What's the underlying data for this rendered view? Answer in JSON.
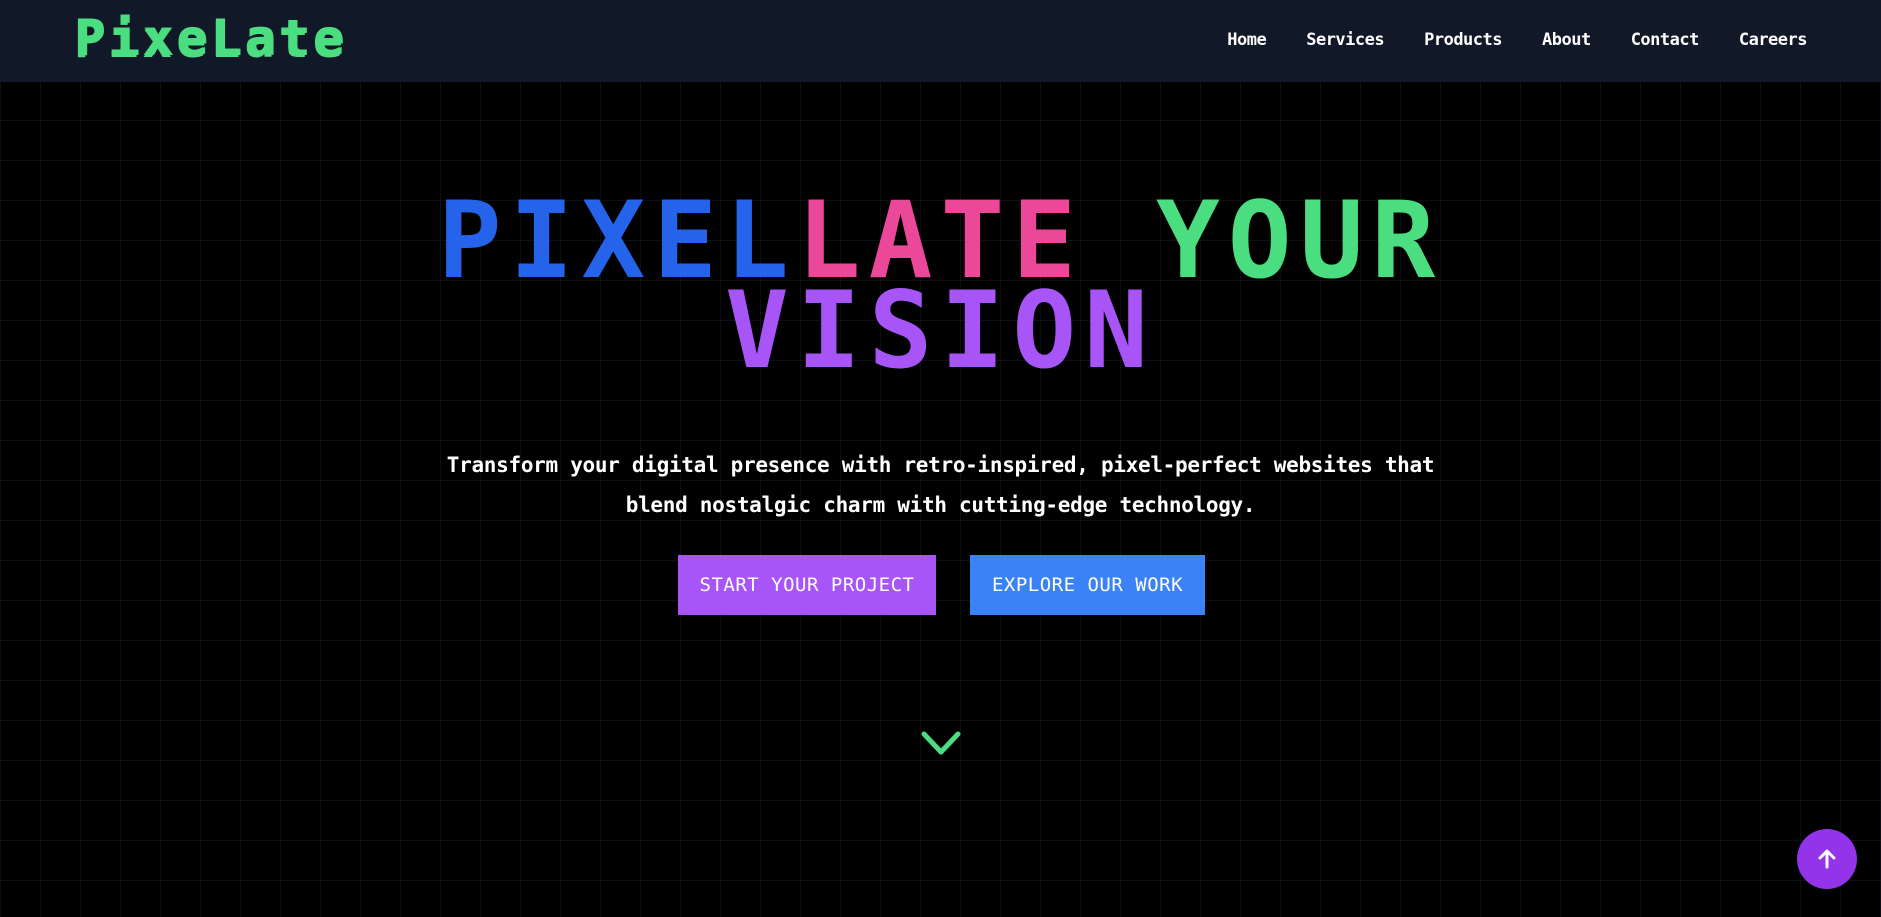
{
  "brand": {
    "logo_text": "PixeLate",
    "accent_green": "#4ade80",
    "accent_purple": "#a855f7",
    "accent_blue": "#2563eb",
    "accent_pink": "#ec4899"
  },
  "nav": {
    "items": [
      {
        "label": "Home"
      },
      {
        "label": "Services"
      },
      {
        "label": "Products"
      },
      {
        "label": "About"
      },
      {
        "label": "Contact"
      },
      {
        "label": "Careers"
      }
    ]
  },
  "hero": {
    "title_segments": {
      "pixel": "PIXEL",
      "late": "LATE",
      "your": "YOUR",
      "vision": "VISION"
    },
    "subtitle_line1": "Transform your digital presence with retro-inspired, pixel-perfect websites that",
    "subtitle_line2": "blend nostalgic charm with cutting-edge technology.",
    "primary_button": "START YOUR PROJECT",
    "secondary_button": "EXPLORE OUR WORK",
    "scroll_icon": "chevron-down-icon"
  },
  "floating": {
    "back_to_top_icon": "arrow-up-icon"
  }
}
